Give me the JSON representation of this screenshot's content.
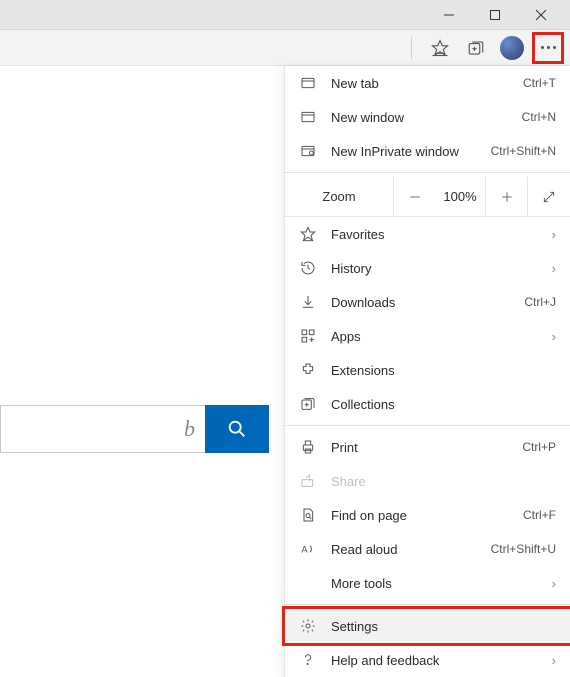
{
  "titlebar": {},
  "menu": {
    "new_tab": "New tab",
    "new_tab_sc": "Ctrl+T",
    "new_window": "New window",
    "new_window_sc": "Ctrl+N",
    "new_inprivate": "New InPrivate window",
    "new_inprivate_sc": "Ctrl+Shift+N",
    "zoom": "Zoom",
    "zoom_value": "100%",
    "favorites": "Favorites",
    "history": "History",
    "downloads": "Downloads",
    "downloads_sc": "Ctrl+J",
    "apps": "Apps",
    "extensions": "Extensions",
    "collections": "Collections",
    "print": "Print",
    "print_sc": "Ctrl+P",
    "share": "Share",
    "find": "Find on page",
    "find_sc": "Ctrl+F",
    "read_aloud": "Read aloud",
    "read_aloud_sc": "Ctrl+Shift+U",
    "more_tools": "More tools",
    "settings": "Settings",
    "help": "Help and feedback"
  }
}
